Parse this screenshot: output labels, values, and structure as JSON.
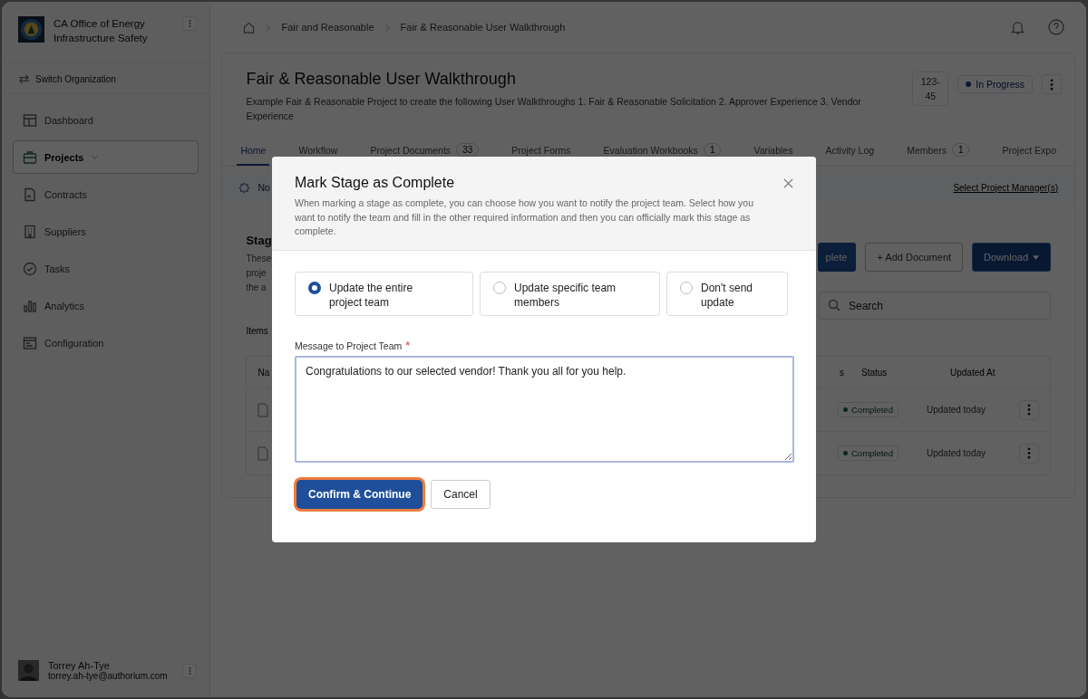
{
  "sidebar": {
    "org_name": "CA Office of Energy Infrastructure Safety",
    "switch_label": "Switch Organization",
    "items": [
      {
        "label": "Dashboard",
        "selected": false
      },
      {
        "label": "Projects",
        "selected": true,
        "submenu": true
      },
      {
        "label": "Contracts",
        "selected": false
      },
      {
        "label": "Suppliers",
        "selected": false
      },
      {
        "label": "Tasks",
        "selected": false
      },
      {
        "label": "Analytics",
        "selected": false
      },
      {
        "label": "Configuration",
        "selected": false
      }
    ],
    "user": {
      "name": "Torrey Ah-Tye",
      "email": "torrey.ah-tye@authorium.com"
    }
  },
  "breadcrumbs": [
    "Fair and Reasonable",
    "Fair & Reasonable User Walkthrough"
  ],
  "project": {
    "title": "Fair & Reasonable User Walkthrough",
    "description": "Example Fair & Reasonable Project to create the following User Walkthroughs 1. Fair & Reasonable Solicitation 2. Approver Experience 3. Vendor Experience",
    "id": "123-45",
    "status": "In Progress"
  },
  "tabs": [
    {
      "label": "Home",
      "selected": true
    },
    {
      "label": "Workflow",
      "selected": false
    },
    {
      "label": "Project Documents",
      "count": "33",
      "selected": false
    },
    {
      "label": "Project Forms",
      "selected": false
    },
    {
      "label": "Evaluation Workbooks",
      "count": "1",
      "selected": false
    },
    {
      "label": "Variables",
      "selected": false
    },
    {
      "label": "Activity Log",
      "selected": false
    },
    {
      "label": "Members",
      "count": "1",
      "selected": false
    },
    {
      "label": "Project Expo",
      "selected": false
    }
  ],
  "banner": {
    "text": "No",
    "link": "Select Project Manager(s)"
  },
  "stage": {
    "title": "Stag",
    "description_lines": [
      "These",
      "proje",
      "the a"
    ],
    "items_label": "Items",
    "buttons": [
      {
        "label": "plete",
        "kind": "primary"
      },
      {
        "label": "+ Add Document",
        "kind": "outline"
      },
      {
        "label": "Download",
        "kind": "dropdown"
      }
    ],
    "search_placeholder": "Search",
    "columns": [
      "Na",
      "s",
      "Status",
      "Updated At"
    ],
    "rows": [
      {
        "status": "Completed",
        "updated": "Updated today"
      },
      {
        "status": "Completed",
        "updated": "Updated today"
      }
    ]
  },
  "modal": {
    "title": "Mark Stage as Complete",
    "description": "When marking a stage as complete, you can choose how you want to notify the project team. Select how you want to notify the team and fill in the other required information and then you can officially mark this stage as complete.",
    "options": [
      {
        "label": "Update the entire project team",
        "selected": true
      },
      {
        "label": "Update specific team members",
        "selected": false
      },
      {
        "label": "Don't send update",
        "selected": false
      }
    ],
    "message_label": "Message to Project Team",
    "required_mark": "*",
    "message": "Congratulations to our selected vendor! Thank you all for you help.",
    "confirm": "Confirm & Continue",
    "cancel": "Cancel"
  }
}
